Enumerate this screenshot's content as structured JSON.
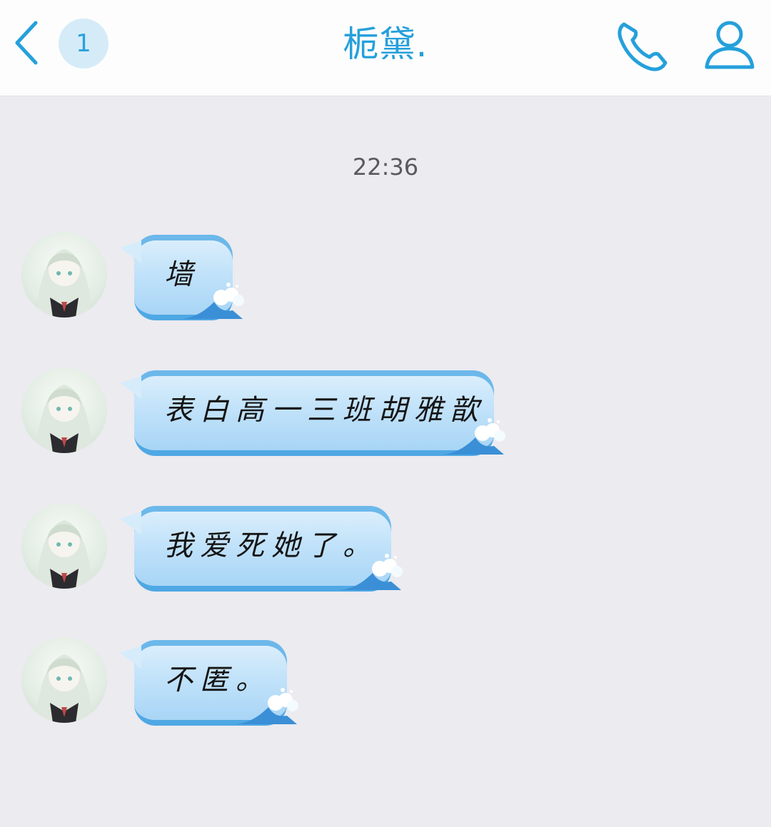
{
  "header": {
    "unread_count": "1",
    "title": "栀黛."
  },
  "chat": {
    "timestamp": "22:36",
    "messages": [
      {
        "text": "墙"
      },
      {
        "text": "表白高一三班胡雅歆"
      },
      {
        "text": "我爱死她了。"
      },
      {
        "text": "不匿。"
      }
    ]
  },
  "colors": {
    "accent": "#25a0db",
    "badge_bg": "#d5ecf8",
    "chat_bg": "#ebebf0",
    "bubble_light": "#dff0fc",
    "bubble_dark": "#4fa8e4"
  },
  "icons": {
    "back": "chevron-left-icon",
    "call": "phone-icon",
    "profile": "user-icon",
    "avatar": "anime-girl-avatar"
  }
}
